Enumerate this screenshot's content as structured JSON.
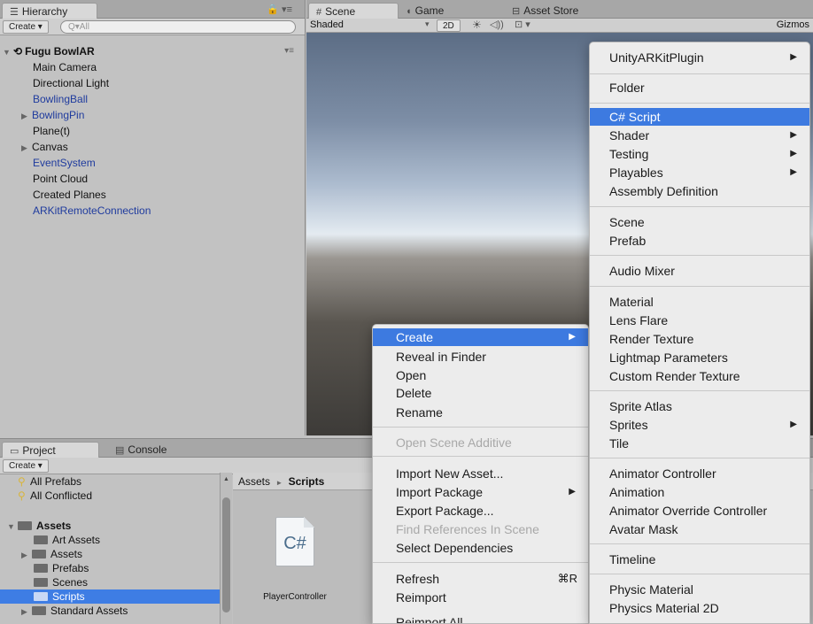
{
  "hierarchy": {
    "tab": "Hierarchy",
    "create_label": "Create",
    "search_placeholder": "Q▾All",
    "scene_name": "Fugu BowlAR",
    "items": [
      {
        "label": "Main Camera"
      },
      {
        "label": "Directional Light"
      },
      {
        "label": "BowlingBall"
      },
      {
        "label": "BowlingPin"
      },
      {
        "label": "Plane(t)"
      },
      {
        "label": "Canvas"
      },
      {
        "label": "EventSystem"
      },
      {
        "label": "Point Cloud"
      },
      {
        "label": "Created Planes"
      },
      {
        "label": "ARKitRemoteConnection"
      }
    ]
  },
  "scene": {
    "tabs": {
      "scene": "Scene",
      "game": "Game",
      "asset_store": "Asset Store"
    },
    "shading": "Shaded",
    "mode_2d": "2D",
    "gizmos": "Gizmos"
  },
  "project": {
    "tabs": {
      "project": "Project",
      "console": "Console"
    },
    "create_label": "Create",
    "favorites": [
      "All Prefabs",
      "All Conflicted"
    ],
    "root": "Assets",
    "folders": [
      "Art Assets",
      "Assets",
      "Prefabs",
      "Scenes",
      "Scripts",
      "Standard Assets"
    ],
    "breadcrumb": {
      "root": "Assets",
      "sep": "►",
      "current": "Scripts"
    },
    "asset": {
      "icon_label": "C#",
      "name": "PlayerController"
    }
  },
  "context_menu": {
    "items": {
      "create": "Create",
      "reveal": "Reveal in Finder",
      "open": "Open",
      "delete": "Delete",
      "rename": "Rename",
      "open_scene_additive": "Open Scene Additive",
      "import_new_asset": "Import New Asset...",
      "import_package": "Import Package",
      "export_package": "Export Package...",
      "find_references": "Find References In Scene",
      "select_dependencies": "Select Dependencies",
      "refresh": "Refresh",
      "refresh_shortcut": "⌘R",
      "reimport": "Reimport",
      "reimport_all": "Reimport All"
    }
  },
  "create_submenu": {
    "items": {
      "unityarkit": "UnityARKitPlugin",
      "folder": "Folder",
      "csharp_script": "C# Script",
      "shader": "Shader",
      "testing": "Testing",
      "playables": "Playables",
      "assembly_definition": "Assembly Definition",
      "scene": "Scene",
      "prefab": "Prefab",
      "audio_mixer": "Audio Mixer",
      "material": "Material",
      "lens_flare": "Lens Flare",
      "render_texture": "Render Texture",
      "lightmap_parameters": "Lightmap Parameters",
      "custom_render_texture": "Custom Render Texture",
      "sprite_atlas": "Sprite Atlas",
      "sprites": "Sprites",
      "tile": "Tile",
      "animator_controller": "Animator Controller",
      "animation": "Animation",
      "animator_override_controller": "Animator Override Controller",
      "avatar_mask": "Avatar Mask",
      "timeline": "Timeline",
      "physic_material": "Physic Material",
      "physics_material_2d": "Physics Material 2D"
    }
  },
  "colors": {
    "selection": "#3d7ae0",
    "prefab_text": "#1f3b9e"
  }
}
